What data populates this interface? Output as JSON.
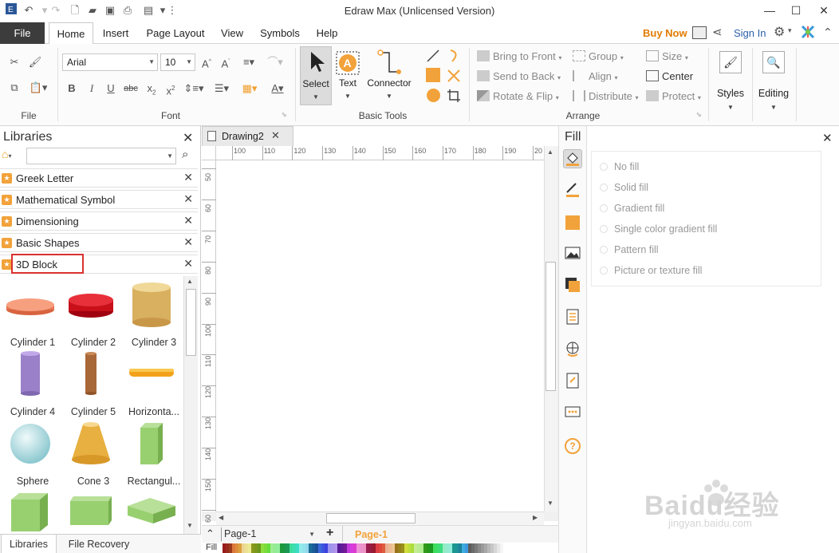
{
  "window": {
    "title": "Edraw Max (Unlicensed Version)"
  },
  "menu": {
    "file": "File",
    "tabs": [
      "Home",
      "Insert",
      "Page Layout",
      "View",
      "Symbols",
      "Help"
    ],
    "buy_now": "Buy Now",
    "sign_in": "Sign In"
  },
  "ribbon": {
    "groups": {
      "file": "File",
      "font": "Font",
      "basic_tools": "Basic Tools",
      "arrange": "Arrange"
    },
    "font_name": "Arial",
    "font_size": "10",
    "tools": {
      "select": "Select",
      "text": "Text",
      "connector": "Connector"
    },
    "arrange": {
      "bring_to_front": "Bring to Front",
      "send_to_back": "Send to Back",
      "rotate_flip": "Rotate & Flip",
      "group": "Group",
      "align": "Align",
      "distribute": "Distribute",
      "size": "Size",
      "center": "Center",
      "protect": "Protect"
    },
    "styles": "Styles",
    "editing": "Editing"
  },
  "libraries": {
    "header": "Libraries",
    "search_placeholder": "",
    "items": [
      "Greek Letter",
      "Mathematical Symbol",
      "Dimensioning",
      "Basic Shapes",
      "3D Block"
    ],
    "shapes": [
      "Cylinder 1",
      "Cylinder 2",
      "Cylinder 3",
      "Cylinder 4",
      "Cylinder 5",
      "Horizonta...",
      "Sphere",
      "Cone 3",
      "Rectangul...",
      "",
      "",
      ""
    ],
    "bottom_tabs": [
      "Libraries",
      "File Recovery"
    ]
  },
  "document": {
    "tab": "Drawing2",
    "ruler_top": [
      "100",
      "110",
      "120",
      "130",
      "140",
      "150",
      "160",
      "170",
      "180",
      "190",
      "20"
    ],
    "ruler_left": [
      "50",
      "60",
      "70",
      "80",
      "90",
      "100",
      "110",
      "120",
      "130",
      "140",
      "150",
      "60"
    ],
    "page_select": "Page-1",
    "page_tab": "Page-1",
    "fill_label": "Fill"
  },
  "fill_panel": {
    "title": "Fill",
    "options": [
      "No fill",
      "Solid fill",
      "Gradient fill",
      "Single color gradient fill",
      "Pattern fill",
      "Picture or texture fill"
    ]
  },
  "colors": {
    "accent": "#f2a23a",
    "buy_now": "#e07b00",
    "file_tab": "#3c3c3c",
    "highlight": "#d9312f"
  },
  "watermark": {
    "brand": "Baidu经验",
    "url": "jingyan.baidu.com"
  }
}
